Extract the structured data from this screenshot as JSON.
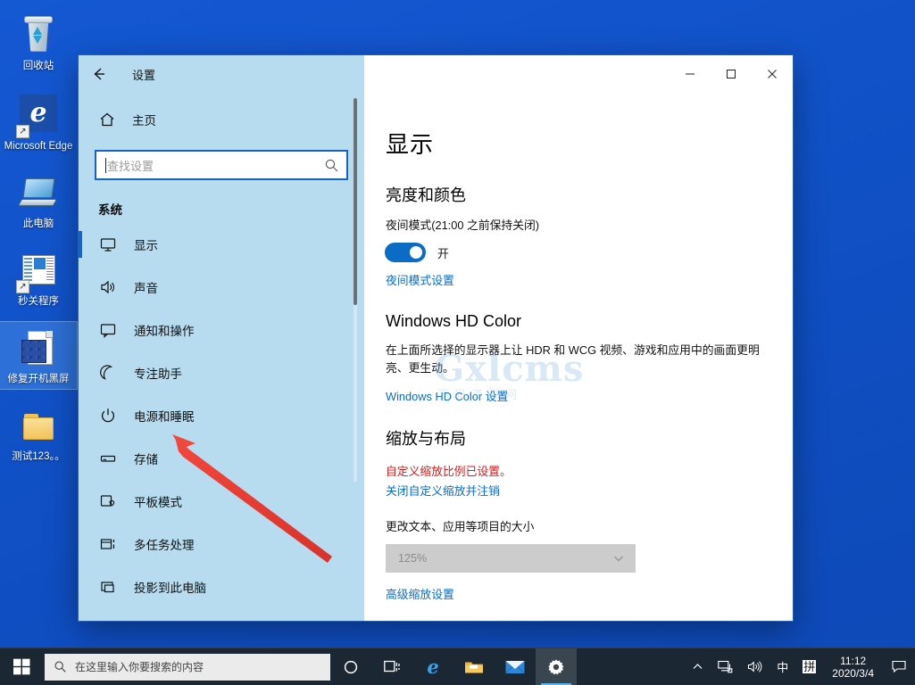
{
  "desktop": {
    "icons": [
      {
        "label": "回收站",
        "icon": "recycle-bin-icon",
        "selected": false
      },
      {
        "label": "Microsoft Edge",
        "icon": "microsoft-edge-icon",
        "selected": false
      },
      {
        "label": "此电脑",
        "icon": "this-pc-icon",
        "selected": false
      },
      {
        "label": "秒关程序",
        "icon": "program-shortcut-icon",
        "selected": false
      },
      {
        "label": "修复开机黑屏",
        "icon": "document-icon",
        "selected": true
      },
      {
        "label": "测试123。。",
        "icon": "folder-icon",
        "selected": false
      }
    ]
  },
  "window": {
    "title": "设置",
    "back_icon": "back-arrow-icon",
    "controls": {
      "minimize": "minimize-icon",
      "maximize": "maximize-icon",
      "close": "close-icon"
    }
  },
  "sidebar": {
    "home_label": "主页",
    "home_icon": "home-icon",
    "search": {
      "placeholder": "查找设置",
      "value": "",
      "icon": "search-icon"
    },
    "section_title": "系统",
    "items": [
      {
        "label": "显示",
        "icon": "monitor-icon",
        "active": true
      },
      {
        "label": "声音",
        "icon": "speaker-icon",
        "active": false
      },
      {
        "label": "通知和操作",
        "icon": "notification-icon",
        "active": false
      },
      {
        "label": "专注助手",
        "icon": "moon-icon",
        "active": false
      },
      {
        "label": "电源和睡眠",
        "icon": "power-icon",
        "active": false
      },
      {
        "label": "存储",
        "icon": "storage-icon",
        "active": false
      },
      {
        "label": "平板模式",
        "icon": "tablet-icon",
        "active": false
      },
      {
        "label": "多任务处理",
        "icon": "multitask-icon",
        "active": false
      },
      {
        "label": "投影到此电脑",
        "icon": "project-icon",
        "active": false
      }
    ]
  },
  "main": {
    "page_title": "显示",
    "brightness": {
      "heading": "亮度和颜色",
      "night_light_label": "夜间模式(21:00 之前保持关闭)",
      "toggle_state": "开",
      "toggle_on": true,
      "settings_link": "夜间模式设置"
    },
    "hd_color": {
      "heading": "Windows HD Color",
      "description": "在上面所选择的显示器上让 HDR 和 WCG 视频、游戏和应用中的画面更明亮、更生动。",
      "settings_link": "Windows HD Color 设置"
    },
    "scale": {
      "heading": "缩放与布局",
      "warning": "自定义缩放比例已设置。",
      "turn_off_link": "关闭自定义缩放并注销",
      "size_label": "更改文本、应用等项目的大小",
      "selected_scale": "125%",
      "advanced_link": "高级缩放设置"
    }
  },
  "watermark": {
    "primary": "Gxlcms",
    "secondary": "源码资源网"
  },
  "taskbar": {
    "start_icon": "windows-start-icon",
    "search_placeholder": "在这里输入你要搜索的内容",
    "search_icon": "search-icon",
    "buttons": [
      {
        "name": "cortana-icon",
        "label": ""
      },
      {
        "name": "task-view-icon",
        "label": ""
      },
      {
        "name": "microsoft-edge-icon",
        "label": ""
      },
      {
        "name": "file-explorer-icon",
        "label": ""
      },
      {
        "name": "mail-icon",
        "label": ""
      },
      {
        "name": "settings-gear-icon",
        "label": "",
        "active": true
      }
    ],
    "tray": {
      "chevron": "show-hidden-icons-icon",
      "network": "network-icon",
      "volume": "volume-icon",
      "ime_mode": "中",
      "ime_pinyin": "拼",
      "notification": "action-center-icon"
    },
    "clock": {
      "time": "11:12",
      "date": "2020/3/4"
    }
  },
  "colors": {
    "accent": "#0a6cc4",
    "sidebar_bg": "#b7dcf0",
    "desktop_bg": "#1050c8",
    "taskbar_bg": "#1b2733",
    "warning": "#d01c1c",
    "annotation_arrow": "#ef3b30"
  }
}
